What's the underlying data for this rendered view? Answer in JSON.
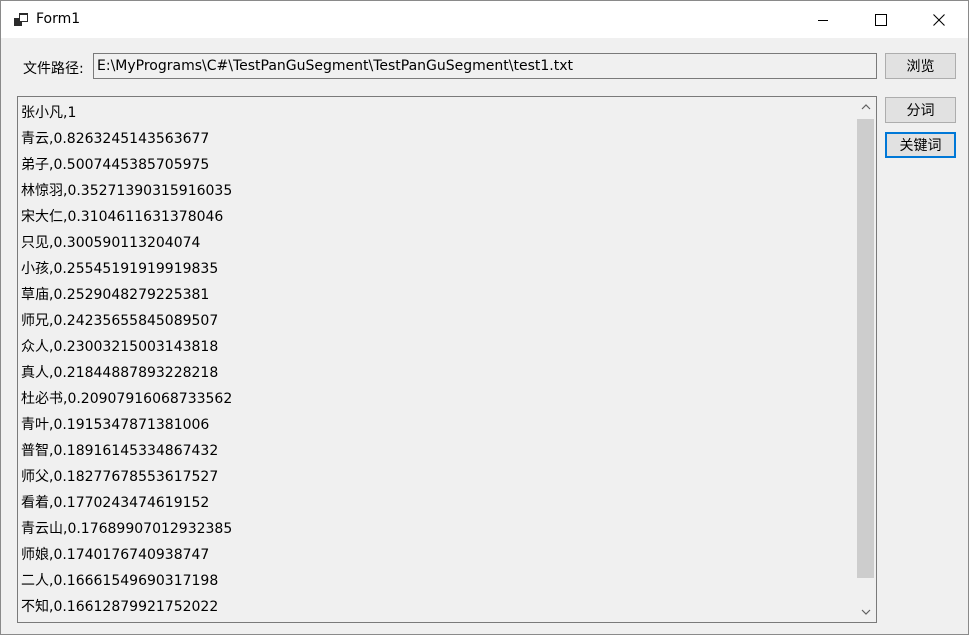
{
  "window": {
    "title": "Form1"
  },
  "form": {
    "path_label": "文件路径:",
    "path_value": "E:\\MyPrograms\\C#\\TestPanGuSegment\\TestPanGuSegment\\test1.txt",
    "browse_label": "浏览",
    "segment_label": "分词",
    "keywords_label": "关键词"
  },
  "results": {
    "lines": [
      "张小凡,1",
      "青云,0.8263245143563677",
      "弟子,0.5007445385705975",
      "林惊羽,0.35271390315916035",
      "宋大仁,0.3104611631378046",
      "只见,0.300590113204074",
      "小孩,0.25545191919919835",
      "草庙,0.2529048279225381",
      "师兄,0.24235655845089507",
      "众人,0.23003215003143818",
      "真人,0.21844887893228218",
      "杜必书,0.20907916068733562",
      "青叶,0.1915347871381006",
      "普智,0.18916145334867432",
      "师父,0.18277678553617527",
      "看着,0.1770243474619152",
      "青云山,0.17689907012932385",
      "师娘,0.1740176740938747",
      "二人,0.16661549690317198",
      "不知,0.16612879921752022"
    ]
  }
}
